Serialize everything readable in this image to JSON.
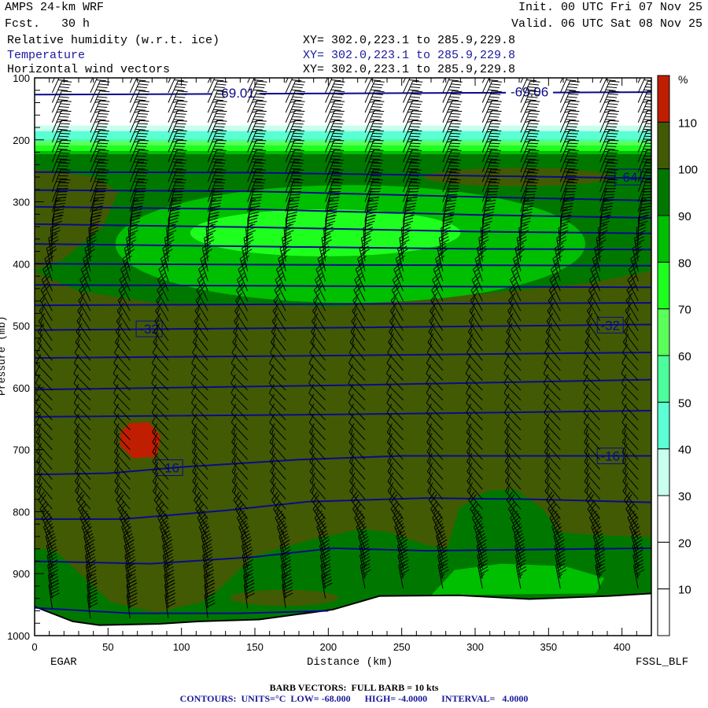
{
  "header": {
    "model": "AMPS 24-km WRF",
    "forecast": "Fcst.   30 h",
    "init": "Init. 00 UTC Fri 07 Nov 25",
    "valid": "Valid. 06 UTC Sat 08 Nov 25",
    "fields": [
      {
        "name": "Relative humidity (w.r.t. ice)",
        "xy": "XY= 302.0,223.1 to 285.9,229.8"
      },
      {
        "name": "Temperature",
        "xy": "XY= 302.0,223.1 to 285.9,229.8"
      },
      {
        "name": "Horizontal wind vectors",
        "xy": "XY= 302.0,223.1 to 285.9,229.8"
      }
    ]
  },
  "footer": {
    "barb_note": "BARB VECTORS:  FULL BARB = 10 kts",
    "contour_note": "CONTOURS:  UNITS=°C  LOW= -68.000      HIGH= -4.0000      INTERVAL=   4.0000"
  },
  "chart_data": {
    "type": "heatmap",
    "title": "Cross-section: Relative humidity (w.r.t. ice), Temperature, Horizontal wind vectors",
    "xlabel": "Distance (km)",
    "ylabel": "Pressure (mb)",
    "xlim": [
      0,
      420
    ],
    "ylim": [
      1000,
      100
    ],
    "x_ticks": [
      "0",
      "50",
      "100",
      "150",
      "200",
      "250",
      "300",
      "350",
      "400"
    ],
    "y_ticks": [
      "100",
      "200",
      "300",
      "400",
      "500",
      "600",
      "700",
      "800",
      "900",
      "1000"
    ],
    "x_endpoints": {
      "left": "EGAR",
      "right": "FSSL_BLF"
    },
    "colorbar": {
      "unit": "%",
      "labels": [
        "110",
        "100",
        "90",
        "80",
        "70",
        "60",
        "50",
        "40",
        "30",
        "20",
        "10"
      ],
      "bands": [
        {
          "range": ">110",
          "color": "#c01e00"
        },
        {
          "range": "100-110",
          "color": "#425a04"
        },
        {
          "range": "90-100",
          "color": "#007800"
        },
        {
          "range": "80-90",
          "color": "#00be00"
        },
        {
          "range": "70-80",
          "color": "#1eff1e"
        },
        {
          "range": "60-70",
          "color": "#5aff5a"
        },
        {
          "range": "50-60",
          "color": "#4cff9c"
        },
        {
          "range": "40-50",
          "color": "#5affd4"
        },
        {
          "range": "30-40",
          "color": "#c8ffee"
        },
        {
          "range": "20-30",
          "color": "#ffffff"
        },
        {
          "range": "10-20",
          "color": "#ffffff"
        },
        {
          "range": "0-10",
          "color": "#ffffff"
        }
      ]
    },
    "rh_background": "100-110",
    "rh_upper_bands": [
      {
        "range": "80-90",
        "top_mb": 100,
        "bottom_mb": 223
      },
      {
        "range": "70-80",
        "top_mb": 100,
        "bottom_mb": 218
      },
      {
        "range": "60-70",
        "top_mb": 100,
        "bottom_mb": 209
      },
      {
        "range": "50-60",
        "top_mb": 100,
        "bottom_mb": 203
      },
      {
        "range": "40-50",
        "top_mb": 100,
        "bottom_mb": 199
      },
      {
        "range": "30-40",
        "top_mb": 100,
        "bottom_mb": 186
      },
      {
        "range": "20-30",
        "top_mb": 100,
        "bottom_mb": 177
      }
    ],
    "rh_regions": [
      {
        "range": "90-100",
        "polygon": [
          [
            0,
            223
          ],
          [
            420,
            223
          ],
          [
            419,
            412
          ],
          [
            377,
            431
          ],
          [
            297,
            450
          ],
          [
            206,
            469
          ],
          [
            83,
            463
          ],
          [
            30,
            444
          ],
          [
            0,
            412
          ]
        ]
      },
      {
        "range": "100-110",
        "polygon": [
          [
            0,
            247
          ],
          [
            41,
            260
          ],
          [
            57,
            285
          ],
          [
            46,
            342
          ],
          [
            19,
            393
          ],
          [
            0,
            412
          ]
        ]
      },
      {
        "range": "100-110",
        "ellipse": {
          "center": [
            329,
            260
          ],
          "rx_km": 64,
          "ry_mb": 15
        }
      },
      {
        "range": "80-90",
        "ellipse": {
          "center": [
            215,
            368
          ],
          "rx_km": 160,
          "ry_mb": 95
        }
      },
      {
        "range": "70-80",
        "ellipse": {
          "center": [
            198,
            350
          ],
          "rx_km": 92,
          "ry_mb": 38
        }
      },
      {
        "range": "90-100",
        "polygon": [
          [
            0,
            859
          ],
          [
            14,
            863
          ],
          [
            33,
            905
          ],
          [
            52,
            946
          ],
          [
            83,
            963
          ],
          [
            115,
            945
          ],
          [
            127,
            922
          ],
          [
            149,
            872
          ],
          [
            187,
            846
          ],
          [
            222,
            828
          ],
          [
            241,
            833
          ],
          [
            267,
            854
          ],
          [
            281,
            859
          ],
          [
            289,
            795
          ],
          [
            308,
            767
          ],
          [
            327,
            764
          ],
          [
            346,
            795
          ],
          [
            357,
            833
          ],
          [
            375,
            837
          ],
          [
            420,
            841
          ],
          [
            420,
            1000
          ],
          [
            0,
            1000
          ]
        ]
      },
      {
        "range": "100-110",
        "ellipse": {
          "center": [
            170,
            939
          ],
          "rx_km": 37,
          "ry_mb": 13
        }
      },
      {
        "range": "80-90",
        "polygon": [
          [
            270,
            935
          ],
          [
            286,
            894
          ],
          [
            318,
            884
          ],
          [
            361,
            888
          ],
          [
            388,
            907
          ],
          [
            382,
            932
          ]
        ]
      },
      {
        "range": ">110",
        "polygon": [
          [
            59,
            670
          ],
          [
            65,
            657
          ],
          [
            78,
            656
          ],
          [
            86,
            679
          ],
          [
            83,
            711
          ],
          [
            67,
            714
          ],
          [
            58,
            692
          ]
        ]
      }
    ],
    "terrain": [
      [
        0,
        953
      ],
      [
        26,
        977
      ],
      [
        44,
        983
      ],
      [
        85,
        981
      ],
      [
        112,
        977
      ],
      [
        153,
        974
      ],
      [
        203,
        958
      ],
      [
        235,
        936
      ],
      [
        289,
        935
      ],
      [
        337,
        941
      ],
      [
        391,
        936
      ],
      [
        420,
        932
      ]
    ],
    "temperature_contours": [
      {
        "value": -68,
        "points": [
          [
            0,
            127
          ],
          [
            210,
            125
          ],
          [
            420,
            123
          ]
        ],
        "labels": [
          {
            "text": "-69.01",
            "km": 137,
            "mb": 124
          },
          {
            "text": "-69.06",
            "km": 337,
            "mb": 122
          }
        ]
      },
      {
        "value": -64,
        "points": [
          [
            0,
            252
          ],
          [
            150,
            253
          ],
          [
            300,
            258
          ],
          [
            420,
            262
          ]
        ],
        "labels": [
          {
            "text": "-64",
            "km": 404,
            "mb": 260
          }
        ]
      },
      {
        "value": -60,
        "points": [
          [
            0,
            281
          ],
          [
            150,
            283
          ],
          [
            300,
            292
          ],
          [
            420,
            298
          ]
        ],
        "labels": []
      },
      {
        "value": -56,
        "points": [
          [
            0,
            308
          ],
          [
            150,
            312
          ],
          [
            300,
            321
          ],
          [
            420,
            326
          ]
        ],
        "labels": []
      },
      {
        "value": -52,
        "points": [
          [
            0,
            336
          ],
          [
            150,
            341
          ],
          [
            300,
            348
          ],
          [
            420,
            351
          ]
        ],
        "labels": []
      },
      {
        "value": -48,
        "points": [
          [
            0,
            368
          ],
          [
            150,
            372
          ],
          [
            300,
            376
          ],
          [
            420,
            377
          ]
        ],
        "labels": []
      },
      {
        "value": -44,
        "points": [
          [
            0,
            400
          ],
          [
            210,
            402
          ],
          [
            420,
            403
          ]
        ],
        "labels": []
      },
      {
        "value": -40,
        "points": [
          [
            0,
            434
          ],
          [
            210,
            436
          ],
          [
            420,
            438
          ]
        ],
        "labels": []
      },
      {
        "value": -36,
        "points": [
          [
            0,
            467
          ],
          [
            210,
            465
          ],
          [
            420,
            463
          ]
        ],
        "labels": []
      },
      {
        "value": -32,
        "points": [
          [
            0,
            507
          ],
          [
            210,
            503
          ],
          [
            420,
            498
          ]
        ],
        "labels": [
          {
            "text": "-32",
            "km": 78,
            "mb": 505
          },
          {
            "text": "-32",
            "km": 392,
            "mb": 499
          }
        ]
      },
      {
        "value": -28,
        "points": [
          [
            0,
            552
          ],
          [
            210,
            548
          ],
          [
            420,
            543
          ]
        ],
        "labels": []
      },
      {
        "value": -24,
        "points": [
          [
            0,
            603
          ],
          [
            210,
            596
          ],
          [
            420,
            587
          ]
        ],
        "labels": []
      },
      {
        "value": -20,
        "points": [
          [
            0,
            647
          ],
          [
            210,
            643
          ],
          [
            420,
            637
          ]
        ],
        "labels": []
      },
      {
        "value": -16,
        "points": [
          [
            0,
            740
          ],
          [
            50,
            738
          ],
          [
            100,
            728
          ],
          [
            180,
            716
          ],
          [
            250,
            710
          ],
          [
            420,
            710
          ]
        ],
        "labels": [
          {
            "text": "-16",
            "km": 92,
            "mb": 729
          },
          {
            "text": "-16",
            "km": 392,
            "mb": 710
          }
        ]
      },
      {
        "value": -12,
        "points": [
          [
            0,
            812
          ],
          [
            60,
            812
          ],
          [
            130,
            798
          ],
          [
            186,
            784
          ],
          [
            267,
            778
          ],
          [
            340,
            780
          ],
          [
            420,
            785
          ]
        ],
        "labels": []
      },
      {
        "value": -8,
        "points": [
          [
            0,
            880
          ],
          [
            79,
            884
          ],
          [
            150,
            873
          ],
          [
            203,
            859
          ],
          [
            267,
            863
          ],
          [
            420,
            859
          ]
        ],
        "labels": []
      },
      {
        "value": -4,
        "points": [
          [
            0,
            955
          ],
          [
            65,
            964
          ],
          [
            140,
            964
          ],
          [
            200,
            960
          ]
        ],
        "labels": []
      }
    ],
    "wind_barbs": {
      "columns_km": [
        12,
        38,
        65,
        91,
        118,
        145,
        171,
        198,
        225,
        251,
        278,
        305,
        331,
        358,
        385,
        411
      ],
      "level_step_mb": 16,
      "top_mb": 108,
      "profile": [
        {
          "mb": 100,
          "dir_deg": 25,
          "kts": 40
        },
        {
          "mb": 300,
          "dir_deg": 20,
          "kts": 50
        },
        {
          "mb": 450,
          "dir_deg": 335,
          "kts": 20
        },
        {
          "mb": 600,
          "dir_deg": 315,
          "kts": 10
        },
        {
          "mb": 800,
          "dir_deg": 320,
          "kts": 15
        },
        {
          "mb": 880,
          "dir_deg": 345,
          "kts": 40
        },
        {
          "mb": 960,
          "dir_deg": 352,
          "kts": 50
        }
      ]
    }
  }
}
